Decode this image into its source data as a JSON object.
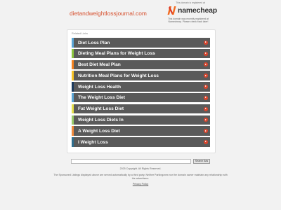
{
  "header": {
    "domain": "dietandweightlossjournal.com",
    "registrar_top_text": "This domain is registered at",
    "registrar_name": "namecheap",
    "registrar_sub_text": "This domain was recently registered at Namecheap. Please check back later!"
  },
  "related_links": {
    "title": "Related Links",
    "items": [
      {
        "label": "Diet Loss Plan",
        "stripe_color": "#5aa6d6"
      },
      {
        "label": "Dieting Meal Plans for Weight Loss",
        "stripe_color": "#8cc63f"
      },
      {
        "label": "Best Diet Meal Plan",
        "stripe_color": "#f58220"
      },
      {
        "label": "Nutrition Meal Plans for Weight Loss",
        "stripe_color": "#f7c325"
      },
      {
        "label": "Weight Loss Health",
        "stripe_color": "#1b3a5c"
      },
      {
        "label": "The Weight Loss Diet",
        "stripe_color": "#5aa6d6"
      },
      {
        "label": "Fat Weight Loss Diet",
        "stripe_color": "#e6e04a"
      },
      {
        "label": "Weight Loss Diets In",
        "stripe_color": "#9acb6a"
      },
      {
        "label": "A Weight Loss Diet",
        "stripe_color": "#f08a3c"
      },
      {
        "label": "I Weight Loss",
        "stripe_color": "#2f6f8f"
      }
    ],
    "arrow_color": "#d8452d"
  },
  "search": {
    "placeholder": "",
    "button_label": "Search Ads"
  },
  "footer": {
    "copyright": "2025 Copyright. All Rights Reserved.",
    "disclaimer": "The Sponsored Listings displayed above are served automatically by a third party. Neither Parkingcrew nor the domain owner maintain any relationship with the advertisers.",
    "privacy_label": "Privacy Policy"
  },
  "colors": {
    "accent": "#d6502e",
    "row_background": "#5a5a5a",
    "page_background": "#f2f2f2"
  }
}
